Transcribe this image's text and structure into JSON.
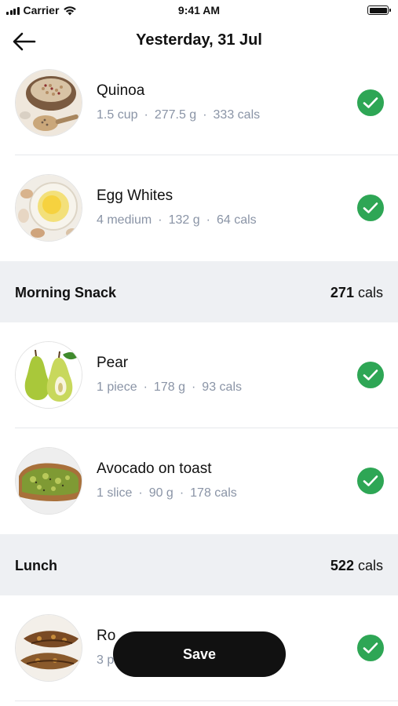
{
  "status_bar": {
    "carrier": "Carrier",
    "time": "9:41 AM"
  },
  "header": {
    "title": "Yesterday, 31 Jul",
    "back_icon": "arrow-left-icon"
  },
  "items_top": [
    {
      "name": "Quinoa",
      "quantity": "1.5 cup",
      "weight": "277.5 g",
      "cals": "333 cals",
      "checked": true
    },
    {
      "name": "Egg Whites",
      "quantity": "4 medium",
      "weight": "132 g",
      "cals": "64 cals",
      "checked": true
    }
  ],
  "sections": [
    {
      "title": "Morning Snack",
      "cals_value": "271",
      "cals_unit": "cals",
      "items": [
        {
          "name": "Pear",
          "quantity": "1 piece",
          "weight": "178 g",
          "cals": "93 cals",
          "checked": true
        },
        {
          "name": "Avocado on toast",
          "quantity": "1 slice",
          "weight": "90 g",
          "cals": "178 cals",
          "checked": true
        }
      ]
    },
    {
      "title": "Lunch",
      "cals_value": "522",
      "cals_unit": "cals",
      "items": [
        {
          "name": "Ro",
          "quantity": "3 p",
          "checked": true
        }
      ]
    }
  ],
  "separator": "·",
  "save_button": {
    "label": "Save"
  },
  "colors": {
    "check_green": "#2ea655",
    "meta_gray": "#8a94a6",
    "section_bg": "#eef0f3",
    "button_black": "#111111"
  }
}
